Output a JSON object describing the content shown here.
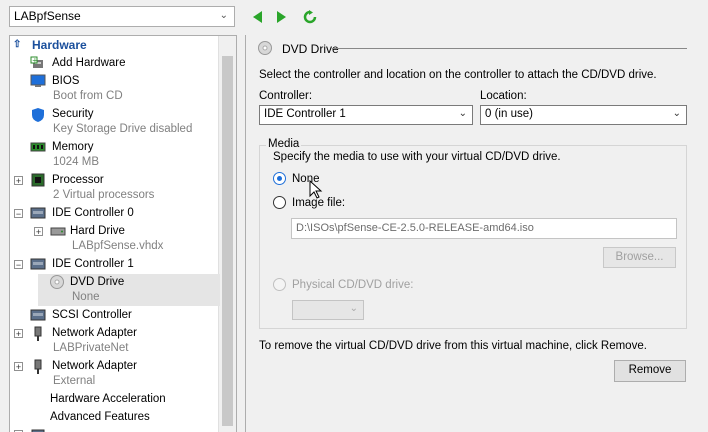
{
  "vm_selector": {
    "value": "LABpfSense"
  },
  "toolbar": {
    "back_icon": "green-triangle-left-icon",
    "forward_icon": "green-triangle-right-icon",
    "refresh_icon": "green-refresh-icon"
  },
  "tree": {
    "header": "Hardware",
    "add_hardware": "Add Hardware",
    "bios": {
      "label": "BIOS",
      "sub": "Boot from CD"
    },
    "security": {
      "label": "Security",
      "sub": "Key Storage Drive disabled"
    },
    "memory": {
      "label": "Memory",
      "sub": "1024 MB"
    },
    "processor": {
      "label": "Processor",
      "sub": "2 Virtual processors"
    },
    "ide0": {
      "label": "IDE Controller 0"
    },
    "hard_drive": {
      "label": "Hard Drive",
      "sub": "LABpfSense.vhdx"
    },
    "ide1": {
      "label": "IDE Controller 1"
    },
    "dvd_drive": {
      "label": "DVD Drive",
      "sub": "None"
    },
    "scsi": {
      "label": "SCSI Controller"
    },
    "net1": {
      "label": "Network Adapter",
      "sub": "LABPrivateNet"
    },
    "net2": {
      "label": "Network Adapter",
      "sub": "External"
    },
    "hw_accel": "Hardware Acceleration",
    "adv_features": "Advanced Features"
  },
  "detail": {
    "title": "DVD Drive",
    "instructions": "Select the controller and location on the controller to attach the CD/DVD drive.",
    "controller_label": "Controller:",
    "controller_value": "IDE Controller 1",
    "location_label": "Location:",
    "location_value": "0 (in use)",
    "media_group": "Media",
    "media_instructions": "Specify the media to use with your virtual CD/DVD drive.",
    "radio_none": "None",
    "radio_image": "Image file:",
    "image_path": "D:\\ISOs\\pfSense-CE-2.5.0-RELEASE-amd64.iso",
    "browse": "Browse...",
    "radio_physical": "Physical CD/DVD drive:",
    "remove_note": "To remove the virtual CD/DVD drive from this virtual machine, click Remove.",
    "remove_button": "Remove"
  },
  "colors": {
    "header_blue": "#1a4f9c",
    "radio_blue": "#1e6fd9"
  }
}
